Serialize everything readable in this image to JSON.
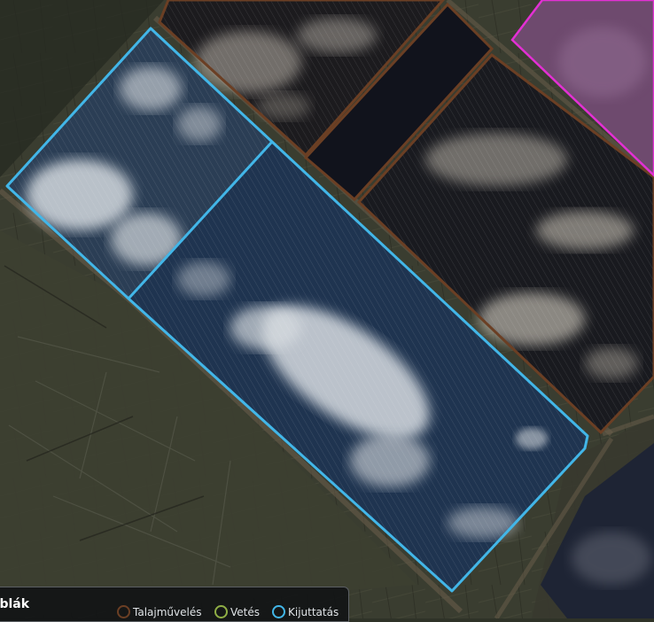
{
  "legend": {
    "title": "áblák",
    "items": [
      {
        "label": "Talajművelés",
        "color": "#6b3f24"
      },
      {
        "label": "Vetés",
        "color": "#8fae45"
      },
      {
        "label": "Kijuttatás",
        "color": "#42b6e8"
      }
    ]
  },
  "colors": {
    "selected_field": "#42b6e8",
    "field_border": "#6b3f24",
    "other_field": "#e330d4"
  }
}
